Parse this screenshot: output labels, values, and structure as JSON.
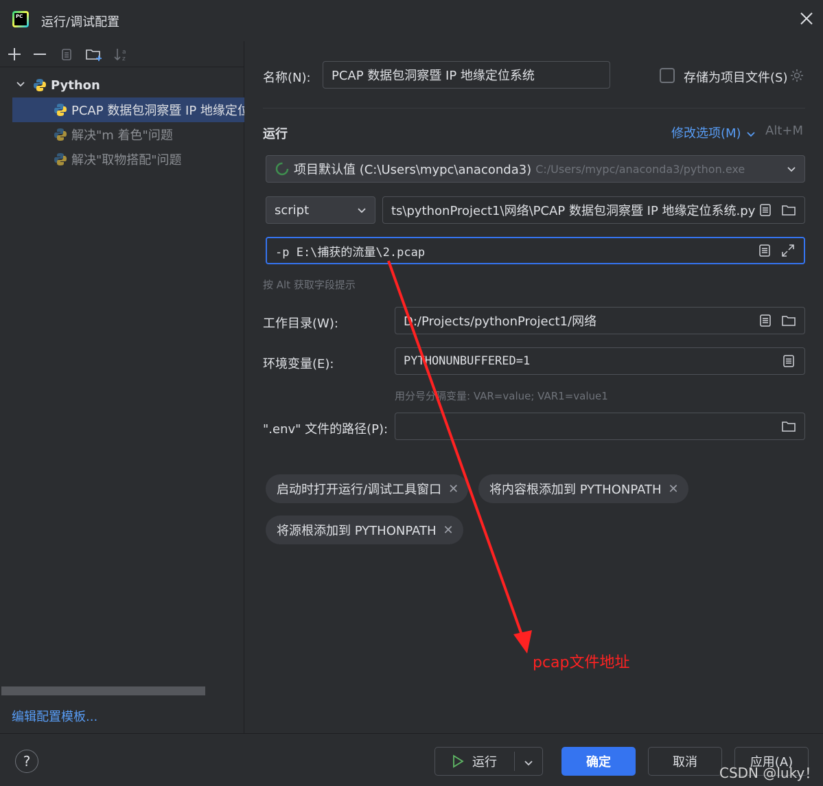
{
  "window": {
    "title": "运行/调试配置",
    "app_icon_text": "PC"
  },
  "toolbar": {
    "add": "+",
    "remove": "—"
  },
  "tree": {
    "group_label": "Python",
    "items": [
      {
        "label": "PCAP 数据包洞察暨 IP 地缘定位"
      },
      {
        "label": "解决\"m 着色\"问题"
      },
      {
        "label": "解决\"取物搭配\"问题"
      }
    ]
  },
  "left_footer": {
    "edit_templates": "编辑配置模板..."
  },
  "form": {
    "name_label": "名称(N):",
    "name_value": "PCAP 数据包洞察暨 IP 地缘定位系统",
    "store_as_project_label": "存储为项目文件(S)",
    "section_run": "运行",
    "modify_options": "修改选项(M)",
    "modify_shortcut": "Alt+M",
    "interpreter_name": "项目默认值 (C:\\Users\\mypc\\anaconda3)",
    "interpreter_path": "C:/Users/mypc/anaconda3/python.exe",
    "script_type": "script",
    "script_path": "ts\\pythonProject1\\网络\\PCAP 数据包洞察暨 IP 地缘定位系统.py",
    "params_value": "-p E:\\捕获的流量\\2.pcap",
    "params_hint": "按 Alt 获取字段提示",
    "workdir_label": "工作目录(W):",
    "workdir_value": "D:/Projects/pythonProject1/网络",
    "env_label": "环境变量(E):",
    "env_value": "PYTHONUNBUFFERED=1",
    "env_hint": "用分号分隔变量: VAR=value; VAR1=value1",
    "dotenv_label": "\".env\" 文件的路径(P):",
    "dotenv_value": ""
  },
  "chips": [
    {
      "label": "启动时打开运行/调试工具窗口"
    },
    {
      "label": "将内容根添加到 PYTHONPATH"
    },
    {
      "label": "将源根添加到 PYTHONPATH"
    }
  ],
  "buttons": {
    "help": "?",
    "run": "运行",
    "ok": "确定",
    "cancel": "取消",
    "apply": "应用(A)"
  },
  "annotation": {
    "text": "pcap文件地址",
    "color": "#ff2222"
  },
  "watermark": "CSDN @luky！",
  "colors": {
    "accent": "#3574f0",
    "link": "#589df6",
    "selection": "#2e436e"
  }
}
